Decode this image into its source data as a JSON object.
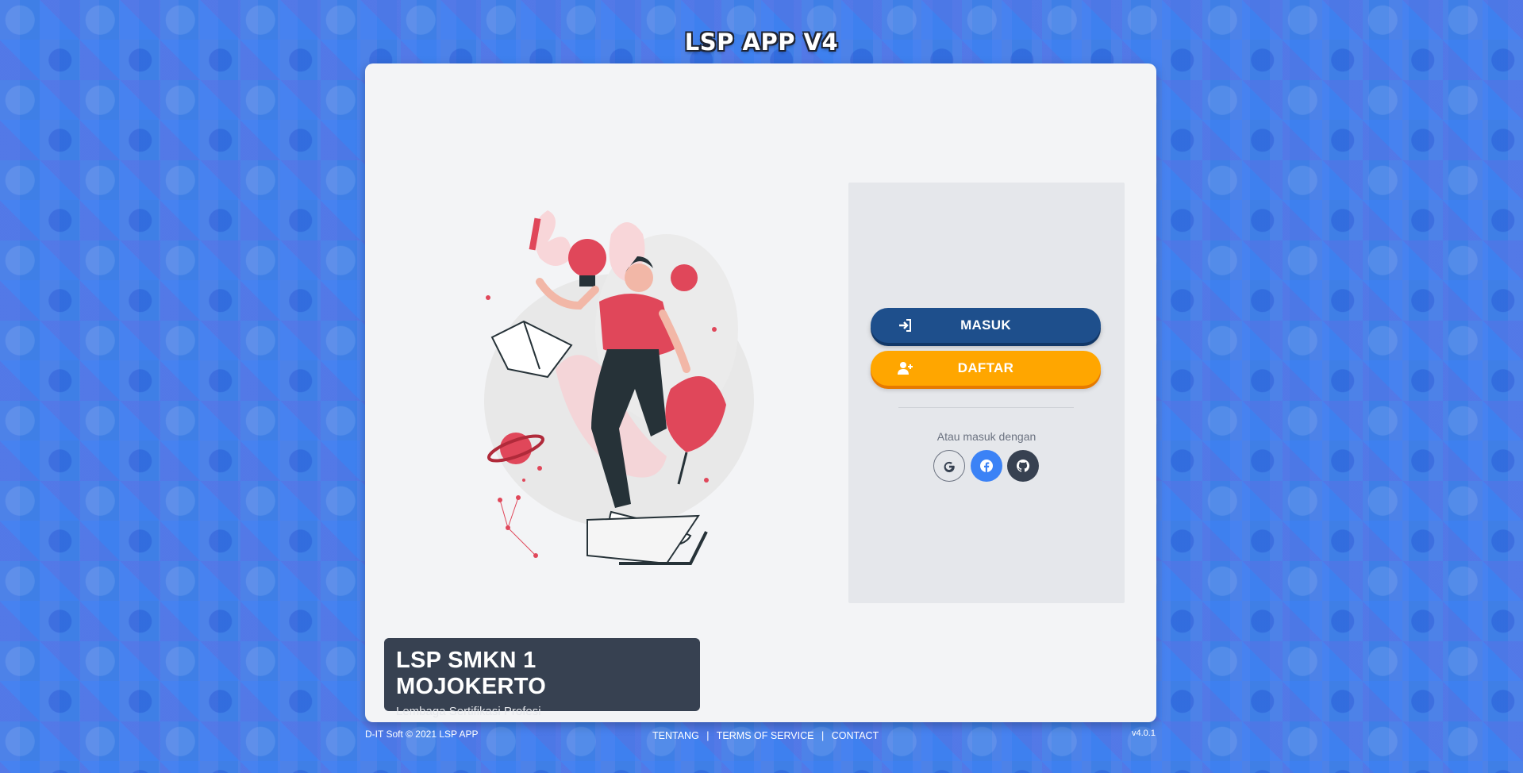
{
  "app_title": "LSP APP V4",
  "login": {
    "masuk_label": "MASUK",
    "daftar_label": "DAFTAR",
    "or_text": "Atau masuk dengan",
    "social": [
      "google-icon",
      "facebook-icon",
      "github-icon"
    ]
  },
  "org": {
    "name": "LSP SMKN 1 MOJOKERTO",
    "tagline": "Lembaga Sertifikasi Profesi"
  },
  "footer": {
    "copyright": "D-IT Soft © 2021 LSP APP",
    "links": [
      "TENTANG",
      "TERMS OF SERVICE",
      "CONTACT"
    ],
    "version": "v4.0.1"
  },
  "colors": {
    "primary": "#1e4f8c",
    "accent": "#ffa600",
    "dark": "#374151",
    "background": "#3f7fe6"
  }
}
